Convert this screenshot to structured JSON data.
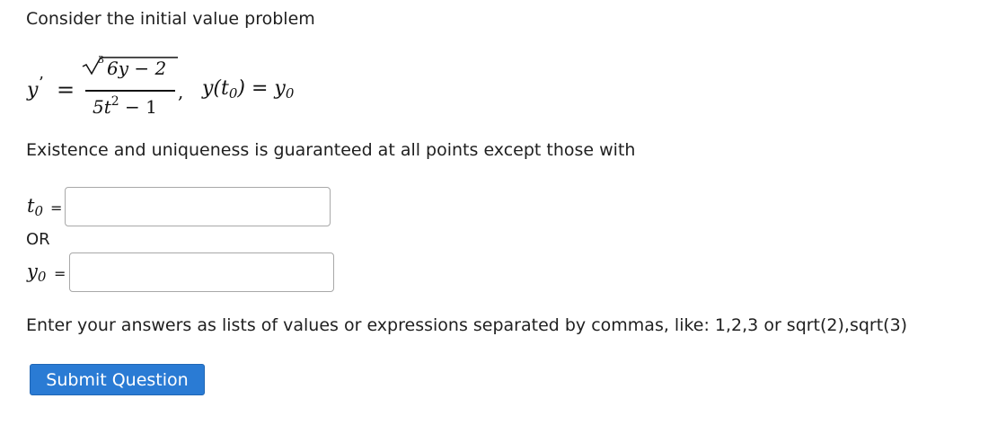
{
  "intro_text": "Consider the initial value problem",
  "equation": {
    "lhs": "y",
    "prime": "’",
    "equals": "=",
    "root_index": "3",
    "numerator": "6y − 2",
    "denominator_base": "5t",
    "denominator_exponent": "2",
    "denominator_tail": " − 1",
    "separator": ",",
    "initial_condition_fn": "y(t",
    "initial_condition_sub": "0",
    "initial_condition_mid": ") = y",
    "initial_condition_sub2": "0"
  },
  "existence_text": "Existence and uniqueness is guaranteed at all points except those with",
  "fields": {
    "t0": {
      "var": "t",
      "sub": "0",
      "equals": "=",
      "value": "",
      "placeholder": ""
    },
    "or_label": "OR",
    "y0": {
      "var": "y",
      "sub": "0",
      "equals": "=",
      "value": "",
      "placeholder": ""
    }
  },
  "instructions_text": "Enter your answers as lists of values or expressions separated by commas, like: 1,2,3 or sqrt(2),sqrt(3)",
  "submit_label": "Submit Question",
  "colors": {
    "button_bg": "#2a7bd4",
    "button_text": "#ffffff",
    "text": "#1f1f1f",
    "input_border": "#a8a8a8"
  }
}
